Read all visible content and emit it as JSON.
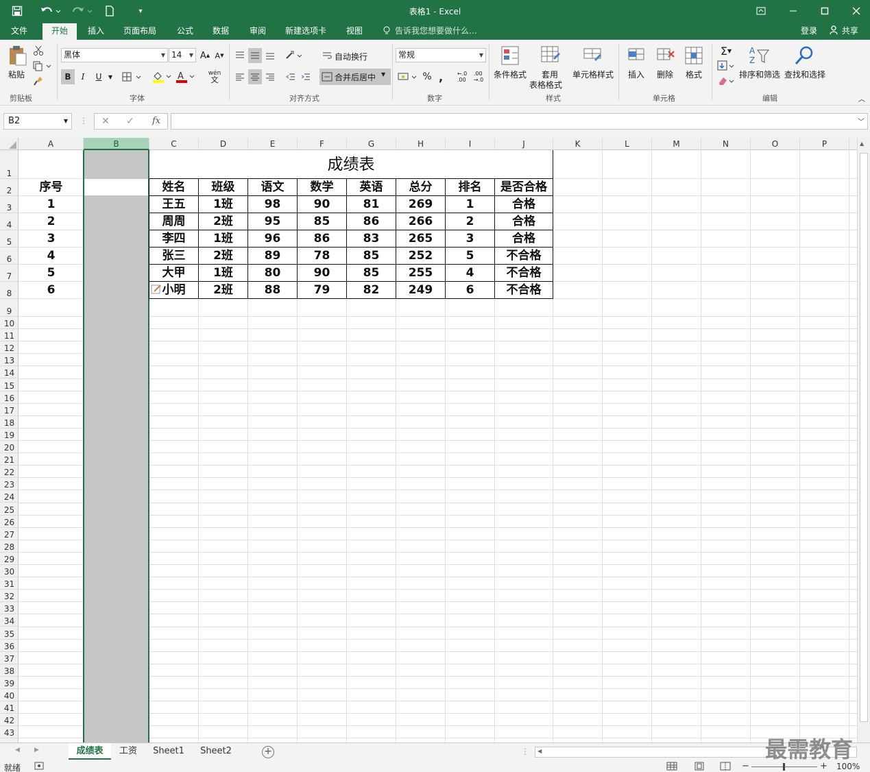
{
  "app": {
    "doc_title": "表格1 - Excel",
    "accent": "#217346",
    "qat": {
      "save_icon": "save-icon",
      "undo_icon": "undo-icon",
      "redo_icon": "redo-icon",
      "new_icon": "new-file-icon",
      "customize_icon": "qat-customize-icon"
    },
    "window": {
      "restore_icon": "ribbon-display-icon",
      "min_icon": "minimize-icon",
      "max_icon": "maximize-icon",
      "close_icon": "close-icon"
    }
  },
  "tabs": [
    {
      "label": "文件"
    },
    {
      "label": "开始"
    },
    {
      "label": "插入"
    },
    {
      "label": "页面布局"
    },
    {
      "label": "公式"
    },
    {
      "label": "数据"
    },
    {
      "label": "审阅"
    },
    {
      "label": "新建选项卡"
    },
    {
      "label": "视图"
    }
  ],
  "tellme": "告诉我您想要做什么...",
  "account": {
    "login": "登录",
    "share": "共享"
  },
  "ribbon": {
    "clipboard": {
      "label": "剪贴板",
      "paste": "粘贴"
    },
    "font": {
      "label": "字体",
      "name": "黑体",
      "size": "14",
      "bold": "B",
      "italic": "I",
      "underline": "U",
      "wen": "wén",
      "wen2": "文"
    },
    "align": {
      "label": "对齐方式",
      "wrap": "自动换行",
      "merge": "合并后居中"
    },
    "number": {
      "label": "数字",
      "format": "常规",
      "percent": "%",
      "comma": ","
    },
    "styles": {
      "label": "样式",
      "cond": "条件格式",
      "table1": "套用",
      "table2": "表格格式",
      "cell": "单元格样式"
    },
    "cells": {
      "label": "单元格",
      "insert": "插入",
      "delete": "删除",
      "format": "格式"
    },
    "editing": {
      "label": "编辑",
      "sort": "排序和筛选",
      "find": "查找和选择"
    }
  },
  "formula": {
    "namebox": "B2",
    "fx": "fx",
    "content": ""
  },
  "columns": [
    "A",
    "B",
    "C",
    "D",
    "E",
    "F",
    "G",
    "H",
    "I",
    "J",
    "K",
    "L",
    "M",
    "N",
    "O",
    "P"
  ],
  "rows": [
    "1",
    "2",
    "3",
    "4",
    "5",
    "6",
    "7",
    "8",
    "9",
    "10",
    "11",
    "12",
    "13",
    "14",
    "15",
    "16",
    "17",
    "18",
    "19",
    "20",
    "21",
    "22",
    "23",
    "24",
    "25",
    "26",
    "27",
    "28",
    "29",
    "30",
    "31",
    "32",
    "33",
    "34",
    "35",
    "36",
    "37",
    "38",
    "39",
    "40",
    "41",
    "42",
    "43"
  ],
  "table": {
    "title": "成绩表",
    "seq_header": "序号",
    "headers": [
      "姓名",
      "班级",
      "语文",
      "数学",
      "英语",
      "总分",
      "排名",
      "是否合格"
    ],
    "seq": [
      "1",
      "2",
      "3",
      "4",
      "5",
      "6"
    ],
    "rows": [
      [
        "王五",
        "1班",
        "98",
        "90",
        "81",
        "269",
        "1",
        "合格"
      ],
      [
        "周周",
        "2班",
        "95",
        "85",
        "86",
        "266",
        "2",
        "合格"
      ],
      [
        "李四",
        "1班",
        "96",
        "86",
        "83",
        "265",
        "3",
        "合格"
      ],
      [
        "张三",
        "2班",
        "89",
        "78",
        "85",
        "252",
        "5",
        "不合格"
      ],
      [
        "大甲",
        "1班",
        "80",
        "90",
        "85",
        "255",
        "4",
        "不合格"
      ],
      [
        "小明",
        "2班",
        "88",
        "79",
        "82",
        "249",
        "6",
        "不合格"
      ]
    ]
  },
  "sheets": [
    "成绩表",
    "工资",
    "Sheet1",
    "Sheet2"
  ],
  "status": {
    "ready": "就绪",
    "zoom": "100%"
  },
  "watermark": "最需教育"
}
